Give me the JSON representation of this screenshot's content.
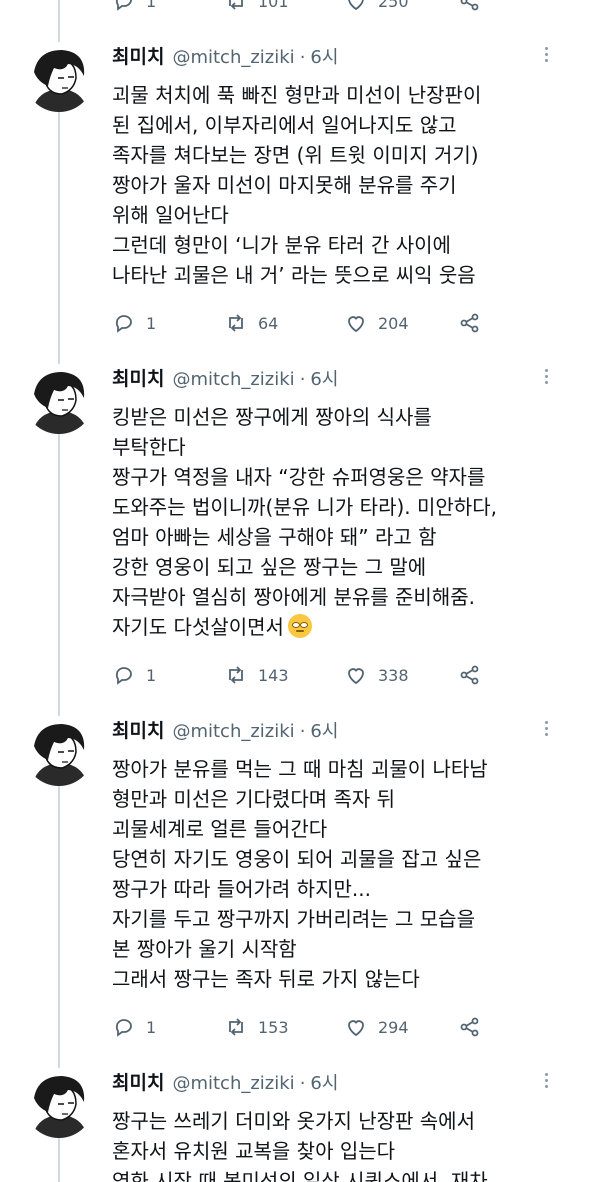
{
  "top_actions": {
    "replies": "1",
    "retweets": "101",
    "likes": "250"
  },
  "tweets": [
    {
      "name": "최미치",
      "handle": "@mitch_ziziki",
      "time": "6시",
      "lines": [
        "괴물 처치에 푹 빠진 형만과 미선이 난장판이",
        "된 집에서, 이부자리에서 일어나지도 않고",
        "족자를 쳐다보는 장면 (위 트윗 이미지 거기)",
        "짱아가 울자 미선이 마지못해 분유를 주기",
        "위해 일어난다",
        "그런데 형만이 ‘니가 분유 타러 간 사이에",
        "나타난 괴물은 내 거’ 라는 뜻으로  씨익 웃음"
      ],
      "replies": "1",
      "retweets": "64",
      "likes": "204"
    },
    {
      "name": "최미치",
      "handle": "@mitch_ziziki",
      "time": "6시",
      "lines": [
        "킹받은 미선은  짱구에게 짱아의 식사를",
        "부탁한다",
        "짱구가 역정을 내자 “강한 슈퍼영웅은 약자를",
        "도와주는 법이니까(분유 니가 타라). 미안하다,",
        "엄마 아빠는 세상을 구해야 돼”  라고 함",
        "강한 영웅이 되고 싶은 짱구는 그 말에",
        "자극받아 열심히 짱아에게 분유를 준비해줌.",
        "자기도 다섯살이면서"
      ],
      "emoji": "rolling-eyes-emoji",
      "replies": "1",
      "retweets": "143",
      "likes": "338"
    },
    {
      "name": "최미치",
      "handle": "@mitch_ziziki",
      "time": "6시",
      "lines": [
        "짱아가 분유를 먹는 그 때 마침 괴물이 나타남",
        "형만과 미선은  기다렸다며 족자 뒤",
        "괴물세계로 얼른 들어간다",
        "당연히 자기도 영웅이 되어 괴물을 잡고 싶은",
        "짱구가 따라 들어가려 하지만...",
        "자기를 두고 짱구까지 가버리려는 그 모습을",
        "본 짱아가 울기 시작함",
        "그래서 짱구는 족자 뒤로 가지 않는다"
      ],
      "replies": "1",
      "retweets": "153",
      "likes": "294"
    },
    {
      "name": "최미치",
      "handle": "@mitch_ziziki",
      "time": "6시",
      "lines": [
        "짱구는 쓰레기 더미와 옷가지 난장판 속에서",
        "혼자서 유치원 교복을 찾아 입는다",
        "영화 시작 때 봉미선의 일상 시퀀스에서, 재차"
      ]
    }
  ]
}
